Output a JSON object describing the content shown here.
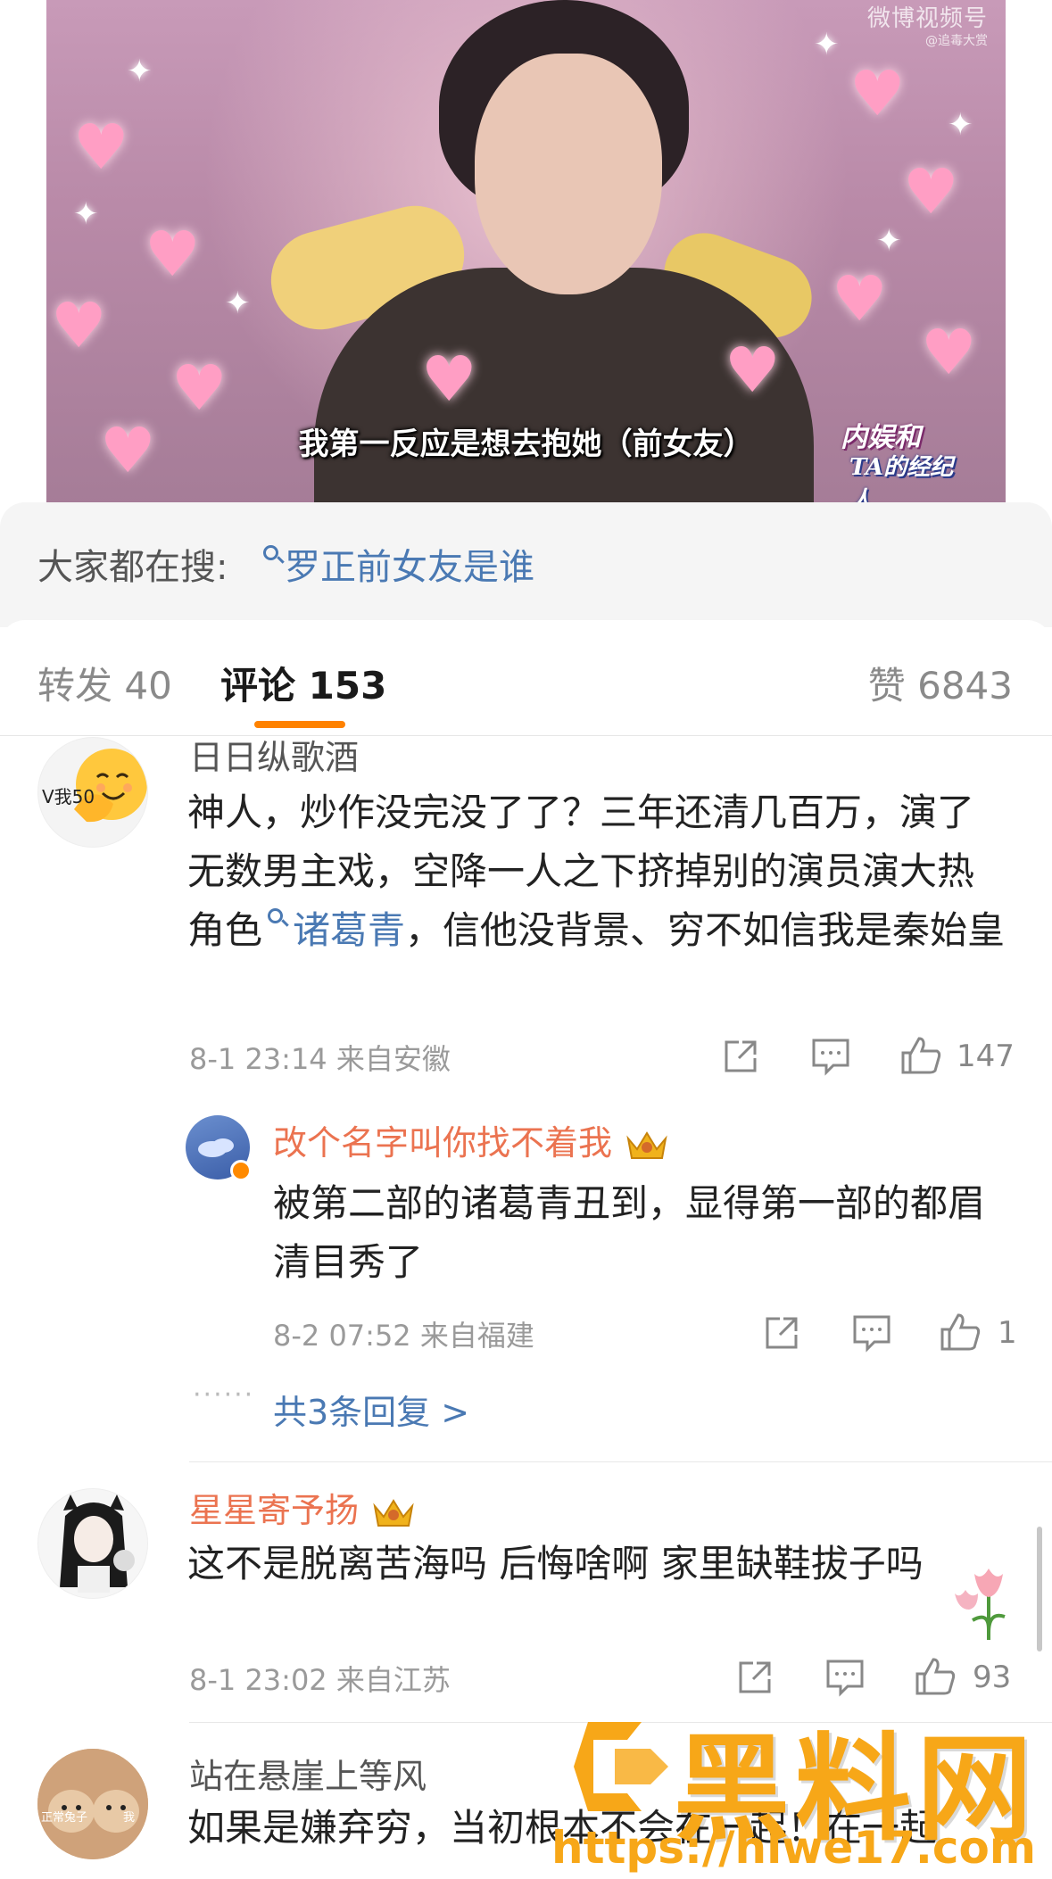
{
  "video": {
    "watermark_brand": "微博视频号",
    "watermark_handle": "@追毒大赏",
    "subtitle": "我第一反应是想去抱她（前女友）",
    "show_logo_line1": "内娱和",
    "show_logo_line2": "TA的经纪人"
  },
  "search": {
    "prefix": "大家都在搜:",
    "query": "罗正前女友是谁"
  },
  "tabs": {
    "repost": "转发 40",
    "comments": "评论 153",
    "likes": "赞 6843"
  },
  "comments": [
    {
      "username": "日日纵歌酒",
      "avatar_badge": "V我50",
      "text_part1": "神人，炒作没完没了了？三年还清几百万，演了无数男主戏，空降一人之下挤掉别的演员演大热角色",
      "topic": "诸葛青",
      "text_part2": "，信他没背景、穷不如信我是秦始皇",
      "meta": "8-1 23:14  来自安徽",
      "likes": "147",
      "reply": {
        "username": "改个名字叫你找不着我",
        "text": "被第二部的诸葛青丑到，显得第一部的都眉清目秀了",
        "meta": "8-2 07:52  来自福建",
        "likes": "1"
      },
      "more_replies": "共3条回复 >"
    },
    {
      "username": "星星寄予扬",
      "text": "这不是脱离苦海吗 后悔啥啊 家里缺鞋拔子吗",
      "meta": "8-1 23:02  来自江苏",
      "likes": "93"
    },
    {
      "username": "站在悬崖上等风",
      "avatar_caption_left": "正常兔子",
      "avatar_caption_right": "我",
      "text": "如果是嫌弃穷，当初根本不会在一起！在一起"
    }
  ],
  "site_watermark": {
    "name": "黑料网",
    "url": "https://hlwe17.com"
  },
  "colors": {
    "accent_orange": "#ff8200",
    "username_orange": "#eb7350",
    "link_blue": "#4a79b3",
    "watermark_gold": "#f7a718"
  }
}
